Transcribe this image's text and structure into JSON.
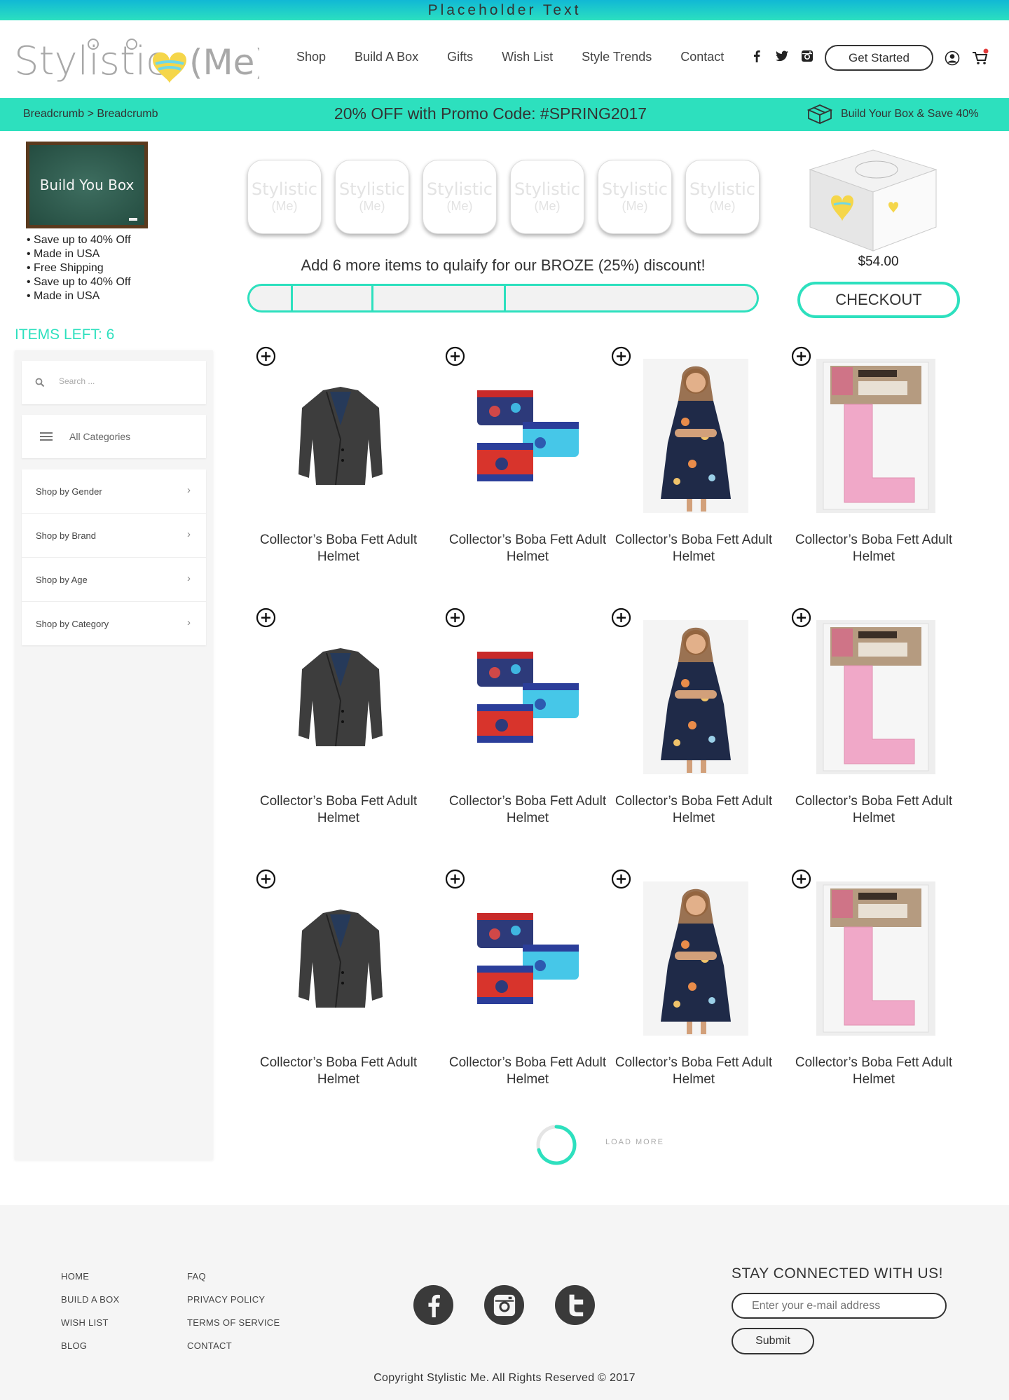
{
  "topbar": {
    "text": "Placeholder Text"
  },
  "header": {
    "logo_text": "Stylistic",
    "logo_suffix": "(Me)",
    "nav": [
      "Shop",
      "Build A Box",
      "Gifts",
      "Wish List",
      "Style Trends",
      "Contact"
    ],
    "get_started": "Get Started",
    "social_icons": [
      "facebook-icon",
      "twitter-icon",
      "instagram-icon"
    ]
  },
  "promobar": {
    "breadcrumb": "Breadcrumb > Breadcrumb",
    "promo": "20% OFF with Promo Code: #SPRING2017",
    "save": "Build Your Box & Save 40%"
  },
  "sidebar": {
    "chalkboard": "Build You Box",
    "perks": [
      "Save up to 40% Off",
      "Made in USA",
      "Free Shipping",
      "Save up to 40% Off",
      "Made in USA"
    ],
    "items_left": "ITEMS LEFT: 6",
    "search_placeholder": "Search ...",
    "all_categories": "All Categories",
    "menu": [
      "Shop by Gender",
      "Shop by Brand",
      "Shop by Age",
      "Shop by Category"
    ]
  },
  "box": {
    "slot_label_1": "Stylistic",
    "slot_label_2": "(Me)",
    "qualify": "Add 6 more items to qulaify for our BROZE (25%) discount!",
    "progress_marks": [
      0.085,
      0.245,
      0.505
    ],
    "price": "$54.00",
    "checkout": "CHECKOUT"
  },
  "products": [
    {
      "name": "Collector’s Boba Fett Adult Helmet",
      "kind": "blazer"
    },
    {
      "name": "Collector’s Boba Fett Adult Helmet",
      "kind": "briefs"
    },
    {
      "name": "Collector’s Boba Fett Adult Helmet",
      "kind": "dress"
    },
    {
      "name": "Collector’s Boba Fett Adult Helmet",
      "kind": "letter"
    },
    {
      "name": "Collector’s Boba Fett Adult Helmet",
      "kind": "blazer"
    },
    {
      "name": "Collector’s Boba Fett Adult Helmet",
      "kind": "briefs"
    },
    {
      "name": "Collector’s Boba Fett Adult Helmet",
      "kind": "dress"
    },
    {
      "name": "Collector’s Boba Fett Adult Helmet",
      "kind": "letter"
    },
    {
      "name": "Collector’s Boba Fett Adult Helmet",
      "kind": "blazer"
    },
    {
      "name": "Collector’s Boba Fett Adult Helmet",
      "kind": "briefs"
    },
    {
      "name": "Collector’s Boba Fett Adult Helmet",
      "kind": "dress"
    },
    {
      "name": "Collector’s Boba Fett Adult Helmet",
      "kind": "letter"
    }
  ],
  "load_more": "LOAD MORE",
  "footer": {
    "col1": [
      "HOME",
      "BUILD A BOX",
      "WISH LIST",
      "BLOG"
    ],
    "col2": [
      "FAQ",
      "PRIVACY POLICY",
      "TERMS OF SERVICE",
      "CONTACT"
    ],
    "social_icons": [
      "facebook-icon",
      "instagram-icon",
      "twitter-icon"
    ],
    "stay": "STAY CONNECTED WITH US!",
    "email_placeholder": "Enter your e-mail address",
    "submit": "Submit",
    "copyright": "Copyright Stylistic Me. All Rights Reserved © 2017"
  },
  "colors": {
    "accent": "#2de0be",
    "top_gradient_start": "#11b8d5"
  }
}
